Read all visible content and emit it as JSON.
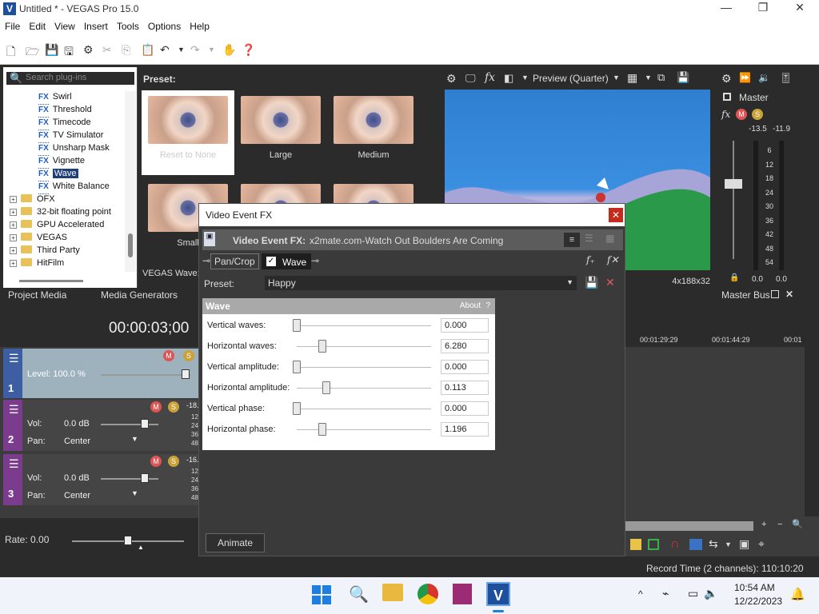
{
  "window": {
    "title": "Untitled * - VEGAS Pro 15.0",
    "app_icon": "V",
    "controls": [
      "—",
      "❐",
      "✕"
    ]
  },
  "menu": [
    "File",
    "Edit",
    "View",
    "Insert",
    "Tools",
    "Options",
    "Help"
  ],
  "plugins": {
    "search_placeholder": "Search plug-ins",
    "fx_items": [
      "Swirl",
      "Threshold",
      "Timecode",
      "TV Simulator",
      "Unsharp Mask",
      "Vignette",
      "Wave",
      "White Balance"
    ],
    "selected": "Wave",
    "folders": [
      "OFX",
      "32-bit floating point",
      "GPU Accelerated",
      "VEGAS",
      "Third Party",
      "HitFilm"
    ],
    "fx_badge": "FX",
    "tree_expand": "+"
  },
  "presets": {
    "label": "Preset:",
    "items": [
      "Reset to None",
      "Large",
      "Medium",
      "Small",
      "",
      ""
    ],
    "footer": "VEGAS Wave:"
  },
  "preview": {
    "mode": "Preview (Quarter)",
    "dims": "4x188x32"
  },
  "master": {
    "label": "Master",
    "peak_left": "-13.5",
    "peak_right": "-11.9",
    "scale": [
      "6",
      "12",
      "18",
      "24",
      "30",
      "36",
      "42",
      "48",
      "54"
    ],
    "bottom_left": "0.0",
    "bottom_right": "0.0",
    "bus_label": "Master Bus"
  },
  "tabs": [
    "Project Media",
    "Media Generators"
  ],
  "timeline": {
    "timecode": "00:00:03;00",
    "ruler": [
      "00:01:29:29",
      "00:01:44:29",
      "00:01"
    ],
    "tracks": [
      {
        "num": "1",
        "level": "Level: 100.0 %"
      },
      {
        "num": "2",
        "vol_label": "Vol:",
        "vol": "0.0 dB",
        "pan_label": "Pan:",
        "pan": "Center",
        "meter": "-18."
      },
      {
        "num": "3",
        "vol_label": "Vol:",
        "vol": "0.0 dB",
        "pan_label": "Pan:",
        "pan": "Center",
        "meter": "-16."
      }
    ],
    "meter_ticks": [
      "12",
      "24",
      "36",
      "48"
    ],
    "rate": "Rate: 0.00"
  },
  "dialog": {
    "title": "Video Event FX",
    "close": "✕",
    "header_label": "Video Event FX:",
    "header_value": "x2mate.com-Watch Out Boulders Are Coming",
    "chain": [
      "Pan/Crop",
      "Wave"
    ],
    "preset_label": "Preset:",
    "preset_value": "Happy",
    "panel_title": "Wave",
    "about": "About",
    "help": "?",
    "params": [
      {
        "label": "Vertical waves:",
        "value": "0.000",
        "pos": 0.0
      },
      {
        "label": "Horizontal waves:",
        "value": "6.280",
        "pos": 0.19
      },
      {
        "label": "Vertical amplitude:",
        "value": "0.000",
        "pos": 0.0
      },
      {
        "label": "Horizontal amplitude:",
        "value": "0.113",
        "pos": 0.22
      },
      {
        "label": "Vertical phase:",
        "value": "0.000",
        "pos": 0.0
      },
      {
        "label": "Horizontal phase:",
        "value": "1.196",
        "pos": 0.19
      }
    ],
    "animate": "Animate"
  },
  "status": {
    "record_time": "Record Time (2 channels): 110:10:20"
  },
  "taskbar": {
    "time": "10:54 AM",
    "date": "12/22/2023"
  }
}
